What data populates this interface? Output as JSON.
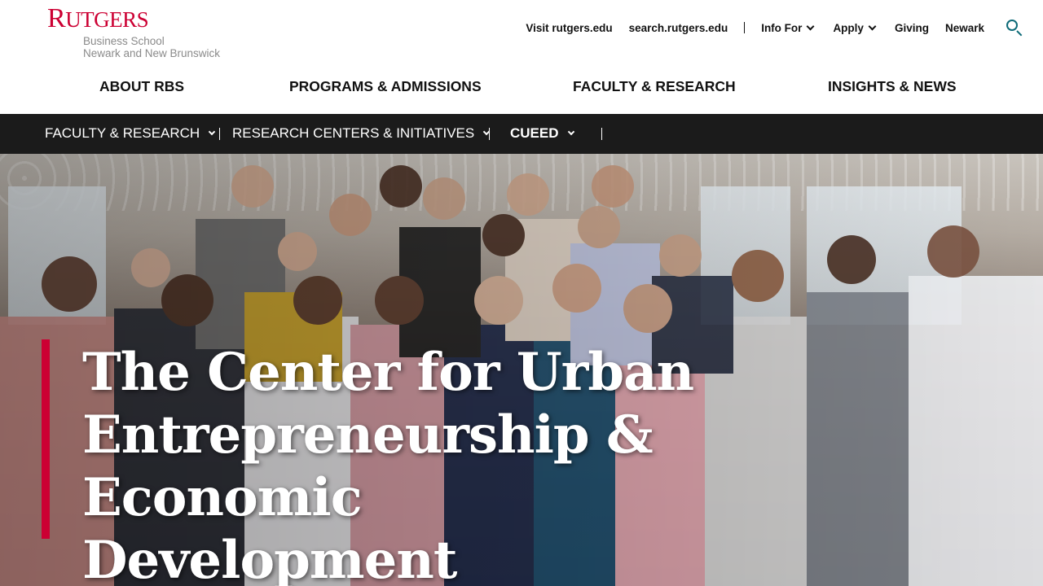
{
  "logo": {
    "wordmark": "Rutgers",
    "line1": "Business School",
    "line2": "Newark and New Brunswick"
  },
  "utility": {
    "links": [
      {
        "label": "Visit rutgers.edu"
      },
      {
        "label": "search.rutgers.edu"
      },
      {
        "label": "Info For"
      },
      {
        "label": "Apply"
      },
      {
        "label": "Giving"
      },
      {
        "label": "Newark"
      }
    ]
  },
  "mainnav": {
    "items": [
      "ABOUT RBS",
      "PROGRAMS & ADMISSIONS",
      "FACULTY & RESEARCH",
      "INSIGHTS & NEWS"
    ]
  },
  "subnav": {
    "items": [
      "FACULTY & RESEARCH",
      "RESEARCH CENTERS & INITIATIVES",
      "CUEED"
    ]
  },
  "hero": {
    "title_line1": "The Center for Urban",
    "title_line2": "Entrepreneurship &",
    "title_line3": "Economic Development"
  },
  "colors": {
    "brand_red": "#cc0033",
    "subnav_bg": "#1b1b1b",
    "search_icon": "#0e6b78"
  }
}
